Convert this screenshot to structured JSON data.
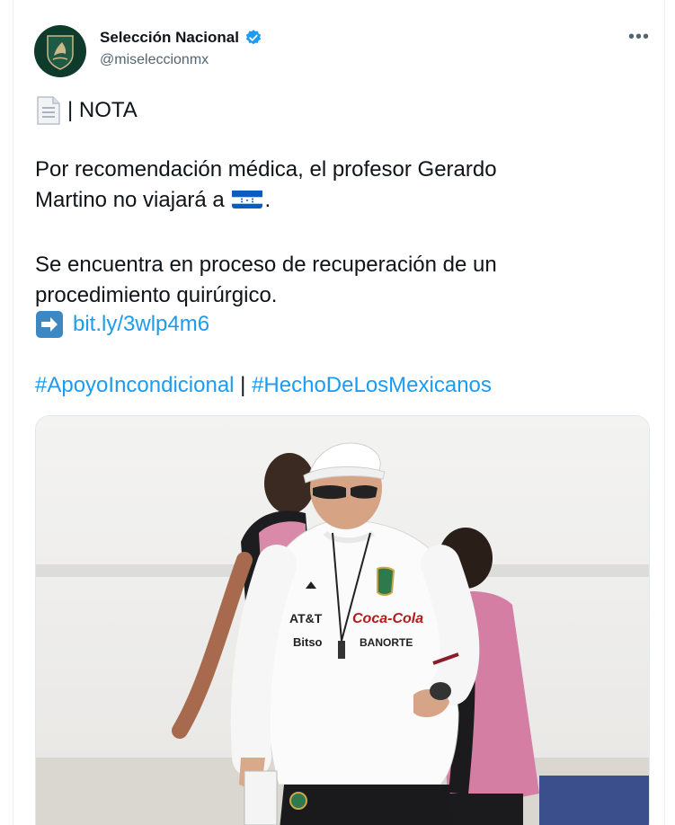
{
  "account": {
    "name": "Selección Nacional",
    "handle": "@miseleccionmx",
    "verified": true
  },
  "tweet": {
    "nota_label": "| NOTA",
    "paragraph_1_line_1": "Por recomendación médica, el profesor Gerardo",
    "paragraph_1_line_2": "Martino no viajará a",
    "paragraph_1_end": ".",
    "paragraph_2_line_1": "Se encuentra en proceso de recuperación de un",
    "paragraph_2_line_2": "procedimiento quirúrgico.",
    "link": "bit.ly/3wlp4m6",
    "hashtag_1": "#ApoyoIncondicional",
    "hashtag_separator": " | ",
    "hashtag_2": "#HechoDeLosMexicanos"
  },
  "photo": {
    "shirt_sponsor_1": "AT&T",
    "shirt_sponsor_2": "Coca-Cola",
    "shirt_sponsor_3": "Bitso",
    "shirt_sponsor_4": "BANORTE"
  },
  "icons": {
    "more": "more-options-icon",
    "verified": "verified-badge-icon",
    "document": "document-icon",
    "arrow": "right-arrow-icon",
    "flag": "honduras-flag-icon"
  },
  "colors": {
    "link": "#1d9bf0",
    "text": "#0f1419",
    "muted": "#536471",
    "verified": "#1d9bf0"
  }
}
